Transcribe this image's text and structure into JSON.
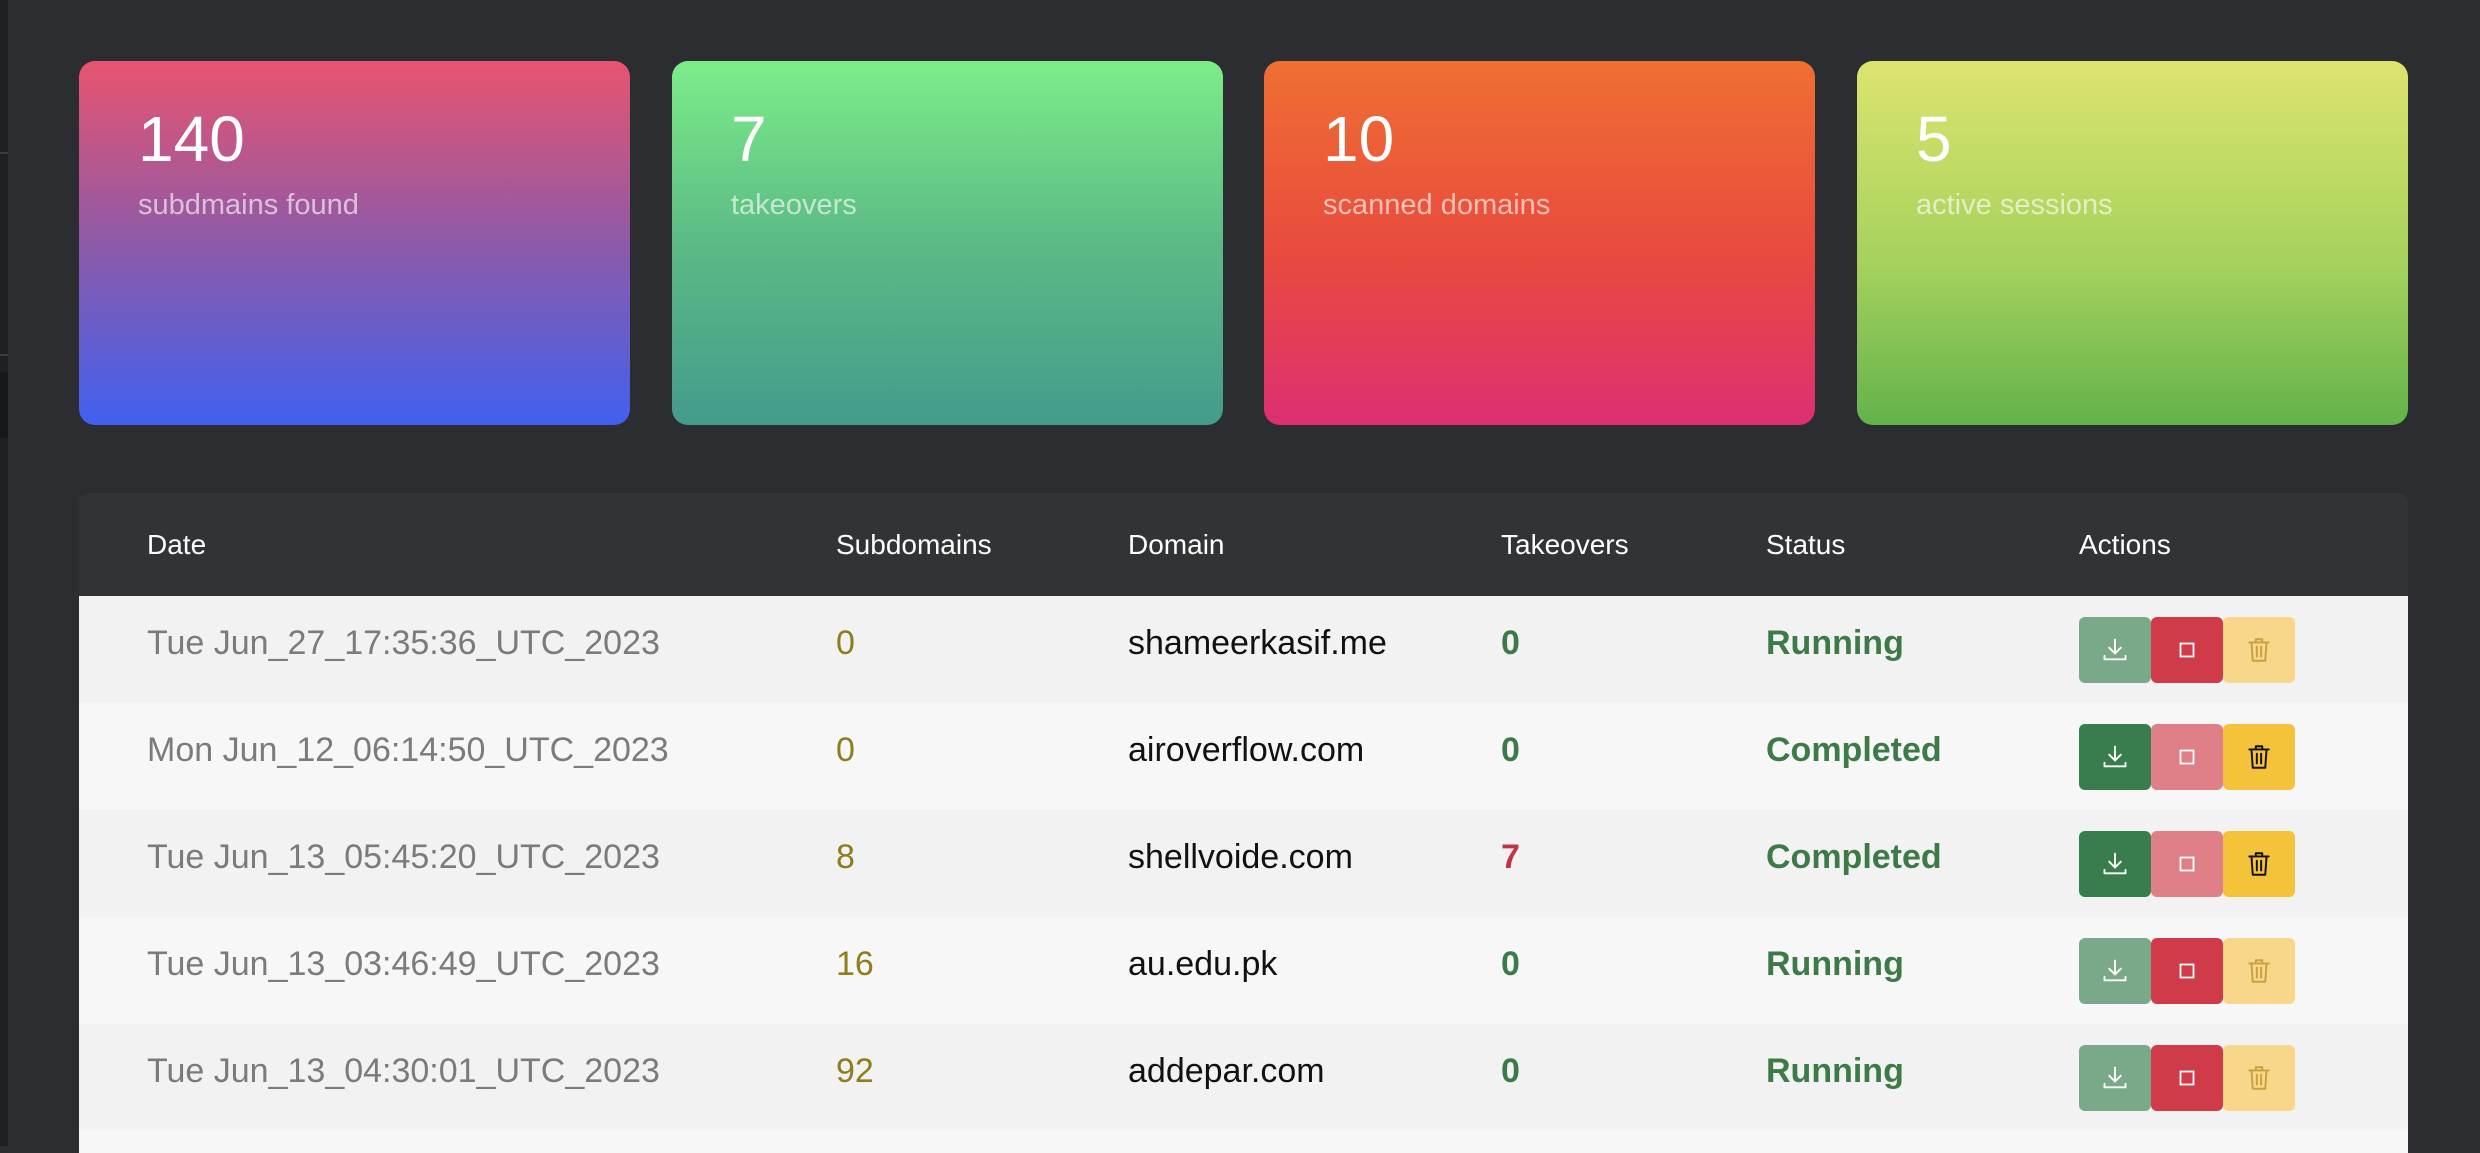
{
  "stats": [
    {
      "value": "140",
      "label": "subdmains found"
    },
    {
      "value": "7",
      "label": "takeovers"
    },
    {
      "value": "10",
      "label": "scanned domains"
    },
    {
      "value": "5",
      "label": "active sessions"
    }
  ],
  "table": {
    "headers": {
      "date": "Date",
      "subdomains": "Subdomains",
      "domain": "Domain",
      "takeovers": "Takeovers",
      "status": "Status",
      "actions": "Actions"
    },
    "rows": [
      {
        "date": "Tue Jun_27_17:35:36_UTC_2023",
        "subdomains": "0",
        "domain": "shameerkasif.me",
        "takeovers": "0",
        "status": "Running"
      },
      {
        "date": "Mon Jun_12_06:14:50_UTC_2023",
        "subdomains": "0",
        "domain": "airoverflow.com",
        "takeovers": "0",
        "status": "Completed"
      },
      {
        "date": "Tue Jun_13_05:45:20_UTC_2023",
        "subdomains": "8",
        "domain": "shellvoide.com",
        "takeovers": "7",
        "status": "Completed"
      },
      {
        "date": "Tue Jun_13_03:46:49_UTC_2023",
        "subdomains": "16",
        "domain": "au.edu.pk",
        "takeovers": "0",
        "status": "Running"
      },
      {
        "date": "Tue Jun_13_04:30:01_UTC_2023",
        "subdomains": "92",
        "domain": "addepar.com",
        "takeovers": "0",
        "status": "Running"
      }
    ]
  },
  "icons": {
    "download": "download-icon",
    "stop": "stop-icon",
    "delete": "trash-icon"
  },
  "colors": {
    "running": "#3d7a47",
    "completed": "#3d7a47",
    "takeover_hit": "#c03546",
    "subdomain_count": "#8e7d1a"
  }
}
